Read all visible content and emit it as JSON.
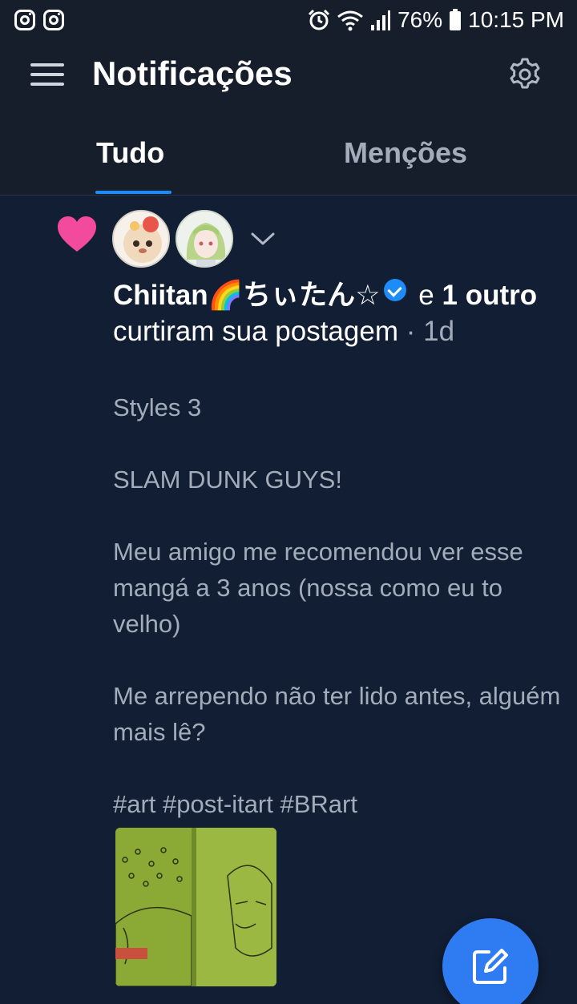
{
  "status_bar": {
    "battery": "76%",
    "time": "10:15 PM",
    "icons": [
      "instagram-icon",
      "instagram-icon",
      "alarm-icon",
      "wifi-icon",
      "signal-icon",
      "battery-icon"
    ]
  },
  "header": {
    "title": "Notificações",
    "icons": [
      "menu-icon",
      "gear-icon"
    ]
  },
  "tabs": [
    {
      "label": "Tudo",
      "selected": true
    },
    {
      "label": "Menções",
      "selected": false
    }
  ],
  "notification": {
    "icon": "heart-icon",
    "user_name": "Chiitan🌈ちぃたん☆",
    "verified": true,
    "joiner": "e",
    "others": "1 outro",
    "action": "curtiram sua postagem",
    "time": "· 1d",
    "post": {
      "lines": [
        "Styles 3",
        "",
        "SLAM DUNK GUYS!",
        "",
        "Meu amigo me recomendou ver esse mangá a 3 anos (nossa como eu to velho)",
        "",
        "Me arrependo não ter lido antes, alguém mais lê?",
        "",
        "#art #post-itart #BRart"
      ]
    }
  },
  "colors": {
    "background": "#121e33",
    "header": "#161e2b",
    "accent": "#1d8cf8",
    "heart": "#f24a9c",
    "muted_text": "#a3acba",
    "fab": "#2f7bf2"
  }
}
